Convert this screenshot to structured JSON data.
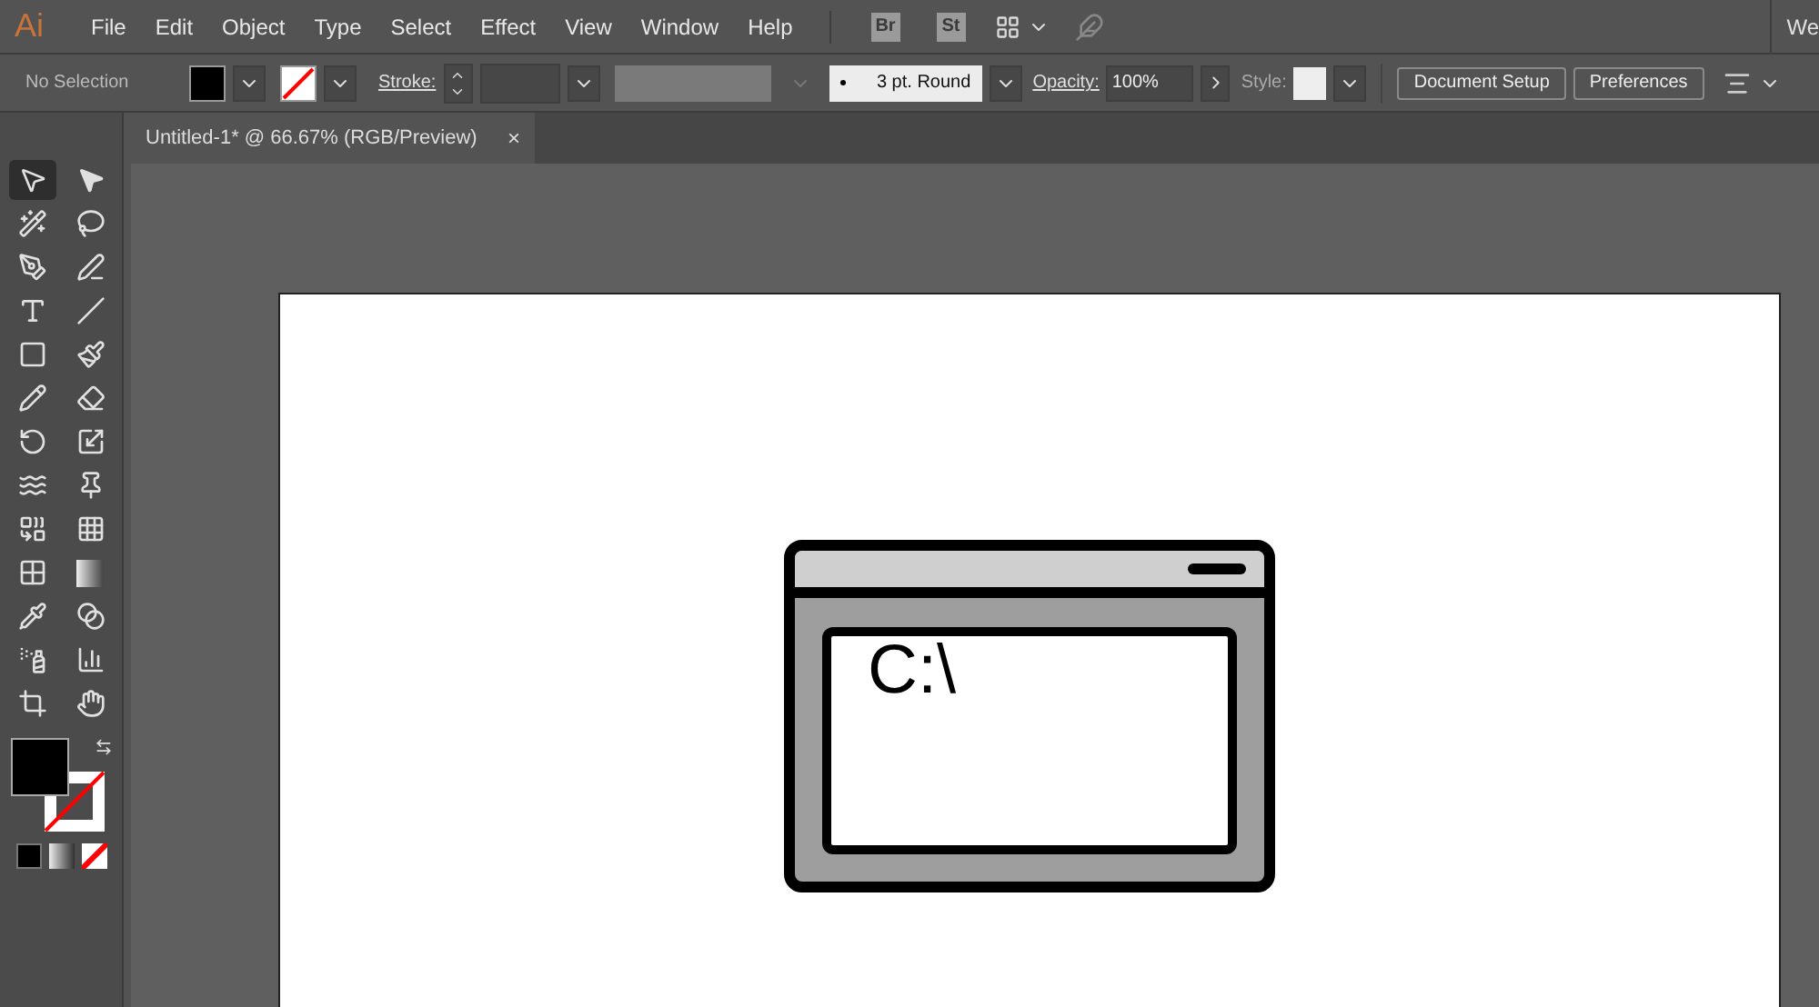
{
  "app_logo": "Ai",
  "menu": [
    "File",
    "Edit",
    "Object",
    "Type",
    "Select",
    "Effect",
    "View",
    "Window",
    "Help"
  ],
  "menu_badges": [
    "Br",
    "St"
  ],
  "workspace_label": "We",
  "control_bar": {
    "selection": "No Selection",
    "stroke_label": "Stroke:",
    "brush": "3 pt. Round",
    "opacity_label": "Opacity:",
    "opacity": "100%",
    "style_label": "Style:",
    "buttons": [
      "Document Setup",
      "Preferences"
    ]
  },
  "tools": [
    {
      "selected": true
    },
    {
      "selected": false
    },
    {
      "selected": false
    },
    {
      "selected": false
    },
    {
      "selected": false
    },
    {
      "selected": false
    },
    {
      "selected": false
    },
    {
      "selected": false
    },
    {
      "selected": false
    },
    {
      "selected": false
    },
    {
      "selected": false
    },
    {
      "selected": false
    },
    {
      "selected": false
    },
    {
      "selected": false
    },
    {
      "selected": false
    },
    {
      "selected": false
    },
    {
      "selected": false
    },
    {
      "selected": false
    },
    {
      "selected": false
    },
    {
      "selected": false
    },
    {
      "selected": false
    },
    {
      "selected": false
    },
    {
      "selected": false
    },
    {
      "selected": false
    },
    {
      "selected": false
    },
    {
      "selected": false
    }
  ],
  "document_tab": {
    "title": "Untitled-1* @ 66.67% (RGB/Preview)",
    "close": "×"
  },
  "artwork_text": "C:\\"
}
